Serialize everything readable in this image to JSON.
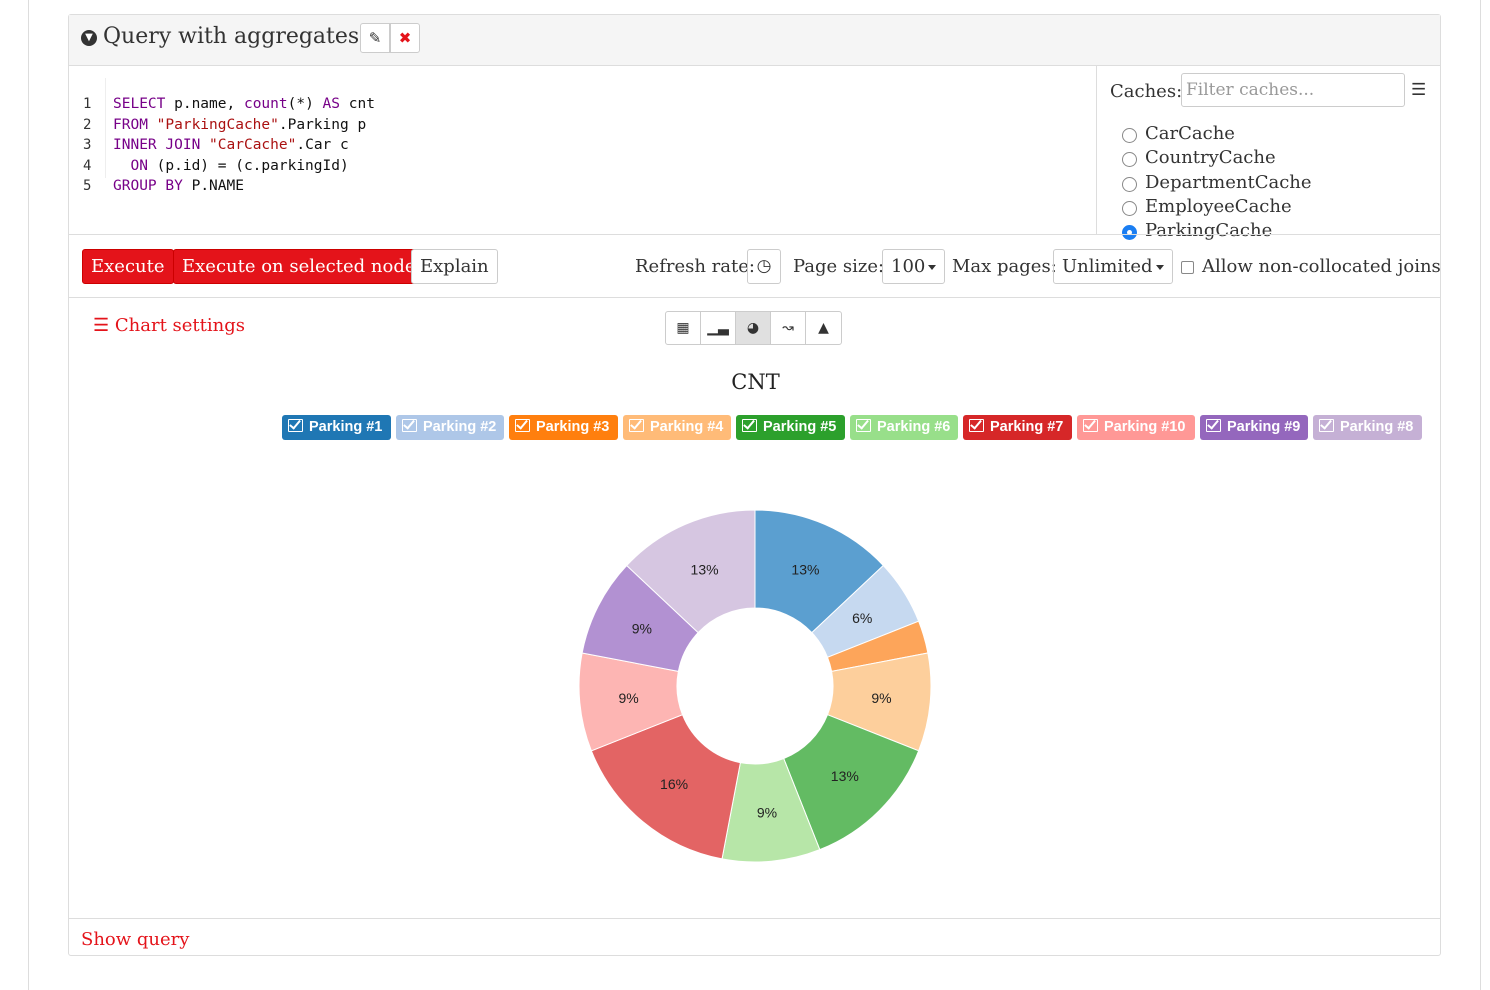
{
  "header": {
    "title": "Query with aggregates",
    "edit_icon": "pencil-icon",
    "delete_icon": "times-icon"
  },
  "editor": {
    "lines": [
      {
        "num": "1",
        "parts": [
          {
            "t": "SELECT",
            "c": "kw"
          },
          {
            "t": " p.name, ",
            "c": "plain"
          },
          {
            "t": "count",
            "c": "kw"
          },
          {
            "t": "(*) ",
            "c": "plain"
          },
          {
            "t": "AS",
            "c": "kw"
          },
          {
            "t": " cnt",
            "c": "plain"
          }
        ]
      },
      {
        "num": "2",
        "parts": [
          {
            "t": "FROM",
            "c": "kw"
          },
          {
            "t": " ",
            "c": "plain"
          },
          {
            "t": "\"ParkingCache\"",
            "c": "str"
          },
          {
            "t": ".Parking p",
            "c": "plain"
          }
        ]
      },
      {
        "num": "3",
        "parts": [
          {
            "t": "INNER",
            "c": "kw"
          },
          {
            "t": " ",
            "c": "plain"
          },
          {
            "t": "JOIN",
            "c": "kw"
          },
          {
            "t": " ",
            "c": "plain"
          },
          {
            "t": "\"CarCache\"",
            "c": "str"
          },
          {
            "t": ".Car c",
            "c": "plain"
          }
        ]
      },
      {
        "num": "4",
        "parts": [
          {
            "t": "  ON",
            "c": "kw"
          },
          {
            "t": " (p.id) = (c.parkingId)",
            "c": "plain"
          }
        ]
      },
      {
        "num": "5",
        "parts": [
          {
            "t": "GROUP",
            "c": "kw"
          },
          {
            "t": " ",
            "c": "plain"
          },
          {
            "t": "BY",
            "c": "kw"
          },
          {
            "t": " P.NAME",
            "c": "plain"
          }
        ]
      }
    ]
  },
  "caches": {
    "label": "Caches:",
    "filter_placeholder": "Filter caches...",
    "items": [
      {
        "name": "CarCache",
        "selected": false
      },
      {
        "name": "CountryCache",
        "selected": false
      },
      {
        "name": "DepartmentCache",
        "selected": false
      },
      {
        "name": "EmployeeCache",
        "selected": false
      },
      {
        "name": "ParkingCache",
        "selected": true
      }
    ]
  },
  "toolbar": {
    "execute": "Execute",
    "execute_node": "Execute on selected node",
    "explain": "Explain",
    "refresh_label": "Refresh rate:",
    "page_size_label": "Page size:",
    "page_size_value": "100",
    "max_pages_label": "Max pages:",
    "max_pages_value": "Unlimited",
    "allow_joins_label": "Allow non-collocated joins"
  },
  "chart_settings": "Chart settings",
  "view_modes": [
    "table-icon",
    "bar-chart-icon",
    "pie-chart-icon",
    "line-chart-icon",
    "area-chart-icon"
  ],
  "chart_data": {
    "type": "pie",
    "title": "CNT",
    "donut": true,
    "slices": [
      {
        "name": "Parking #1",
        "value": 13,
        "label": "13%",
        "color": "#5b9fd0"
      },
      {
        "name": "Parking #2",
        "value": 6,
        "label": "6%",
        "color": "#c6d9f0"
      },
      {
        "name": "Parking #3",
        "value": 3,
        "label": "",
        "color": "#fda55a"
      },
      {
        "name": "Parking #4",
        "value": 9,
        "label": "9%",
        "color": "#fdcf9c"
      },
      {
        "name": "Parking #5",
        "value": 13,
        "label": "13%",
        "color": "#63bb63"
      },
      {
        "name": "Parking #6",
        "value": 9,
        "label": "9%",
        "color": "#b7e6a8"
      },
      {
        "name": "Parking #7",
        "value": 16,
        "label": "16%",
        "color": "#e36464"
      },
      {
        "name": "Parking #10",
        "value": 9,
        "label": "9%",
        "color": "#fdb5b3"
      },
      {
        "name": "Parking #9",
        "value": 9,
        "label": "9%",
        "color": "#b291d2"
      },
      {
        "name": "Parking #8",
        "value": 13,
        "label": "13%",
        "color": "#d6c6e1"
      }
    ],
    "legend": [
      {
        "name": "Parking #1",
        "color": "#1f77b4"
      },
      {
        "name": "Parking #2",
        "color": "#aec7e8"
      },
      {
        "name": "Parking #3",
        "color": "#ff7f0e"
      },
      {
        "name": "Parking #4",
        "color": "#ffbb78"
      },
      {
        "name": "Parking #5",
        "color": "#2ca02c"
      },
      {
        "name": "Parking #6",
        "color": "#98df8a"
      },
      {
        "name": "Parking #7",
        "color": "#d62728"
      },
      {
        "name": "Parking #10",
        "color": "#ff9896"
      },
      {
        "name": "Parking #9",
        "color": "#9467bd"
      },
      {
        "name": "Parking #8",
        "color": "#c5b0d5"
      }
    ]
  },
  "footer": {
    "show_query": "Show query"
  }
}
